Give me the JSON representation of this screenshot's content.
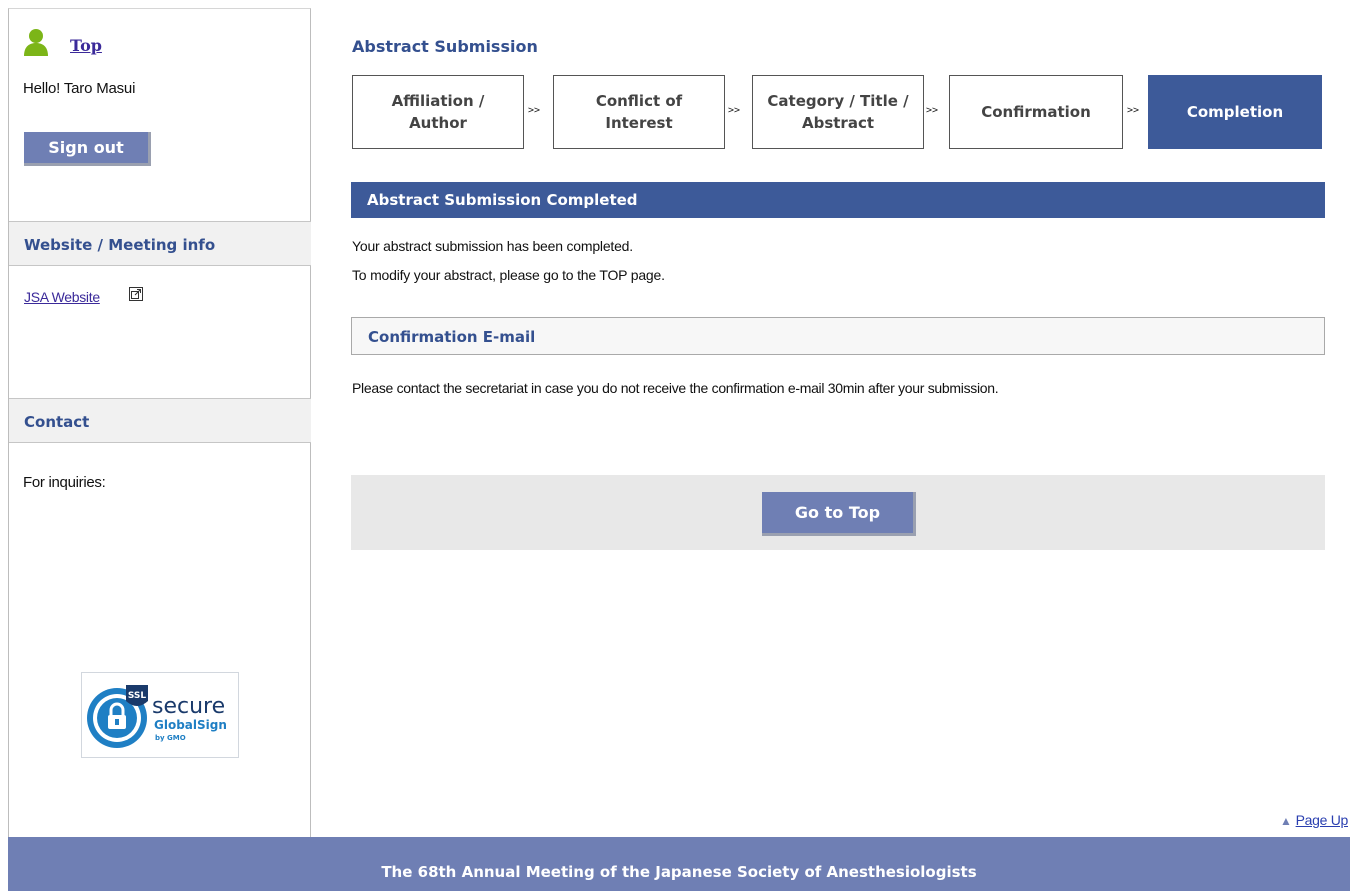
{
  "sidebar": {
    "top_link": "Top",
    "greeting": "Hello! Taro Masui",
    "signout_label": "Sign out",
    "website_heading": "Website / Meeting info",
    "jsa_link": "JSA Website",
    "contact_heading": "Contact",
    "inquiries": "For inquiries:",
    "ssl_badge": {
      "ssl": "SSL",
      "secure": "secure",
      "brand": "GlobalSign",
      "by": "by GMO"
    }
  },
  "main": {
    "title": "Abstract Submission",
    "steps": [
      {
        "line1": "Affiliation /",
        "line2": "Author",
        "active": false
      },
      {
        "line1": "Conflict of",
        "line2": "Interest",
        "active": false
      },
      {
        "line1": "Category / Title /",
        "line2": "Abstract",
        "active": false
      },
      {
        "line1": "Confirmation",
        "line2": "",
        "active": false
      },
      {
        "line1": "Completion",
        "line2": "",
        "active": true
      }
    ],
    "step_separator": ">>",
    "completed_heading": "Abstract Submission Completed",
    "completed_message_1": "Your abstract submission has been completed.",
    "completed_message_2": "To modify your abstract, please go to the TOP page.",
    "email_heading": "Confirmation E-mail",
    "email_message": "Please contact the secretariat in case you do not receive the confirmation e-mail 30min after your submission.",
    "goto_top_label": "Go to Top",
    "page_up_label": "Page Up"
  },
  "footer": {
    "text": "The 68th Annual Meeting of the Japanese Society of Anesthesiologists"
  },
  "colors": {
    "primary": "#3d5a99",
    "button": "#6f7fb4",
    "heading_text": "#34508f",
    "link": "#3b2a9a",
    "user_icon": "#7cb518"
  }
}
